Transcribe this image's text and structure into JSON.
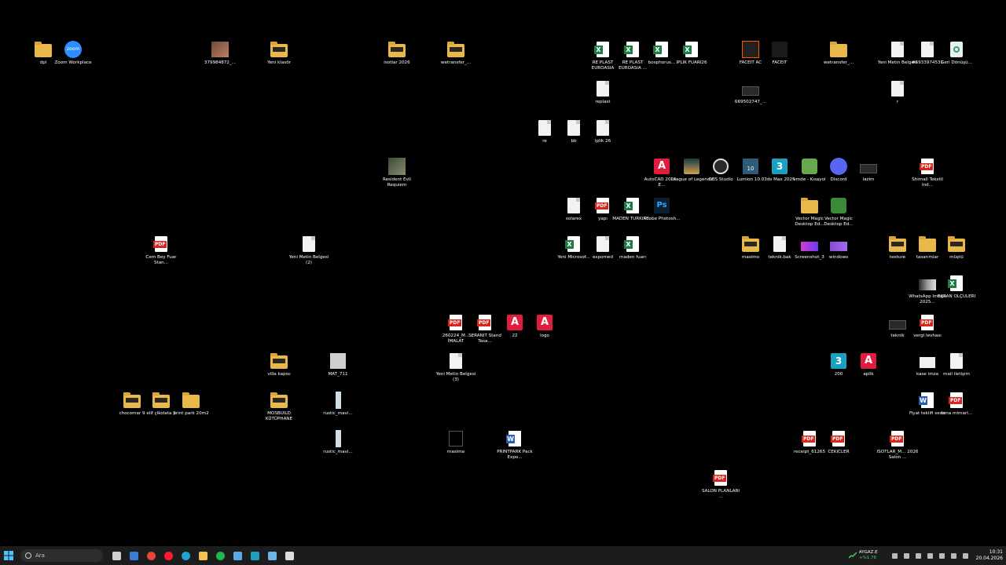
{
  "desktop_icons": [
    {
      "label": "dpi",
      "type": "folder"
    },
    {
      "label": "Zoom Workplace",
      "type": "zoom"
    },
    {
      "label": "379984872_...",
      "type": "img"
    },
    {
      "label": "Yeni klasör",
      "type": "folder-dark"
    },
    {
      "label": "isotlar 2026",
      "type": "folder-dark"
    },
    {
      "label": "wetransfer_...",
      "type": "folder-dark"
    },
    {
      "label": "RE PLAST EUROASIA",
      "type": "xls"
    },
    {
      "label": "RE PLAST EUROASIA ...",
      "type": "xls"
    },
    {
      "label": "bosphorus...",
      "type": "xls"
    },
    {
      "label": "IPLIK FUARI26",
      "type": "xls"
    },
    {
      "label": "FACEIT AC",
      "type": "faceit"
    },
    {
      "label": "FACEIT",
      "type": "faceit2"
    },
    {
      "label": "wetransfer_...",
      "type": "folder"
    },
    {
      "label": "Yeni Metin Belgesi",
      "type": "doc"
    },
    {
      "label": "#6933974531",
      "type": "doc"
    },
    {
      "label": "Geri Dönüşü...",
      "type": "recycle"
    },
    {
      "label": "replast",
      "type": "doc"
    },
    {
      "label": "669502747_...",
      "type": "small"
    },
    {
      "label": "r",
      "type": "doc"
    },
    {
      "label": "re",
      "type": "doc"
    },
    {
      "label": "bb",
      "type": "doc"
    },
    {
      "label": "iplik 26",
      "type": "doc"
    },
    {
      "label": "Resident Evil Requiem",
      "type": "game"
    },
    {
      "label": "AutoCAD 2026 - E...",
      "type": "acad"
    },
    {
      "label": "League of Legends",
      "type": "lol"
    },
    {
      "label": "OBS Studio",
      "type": "obs"
    },
    {
      "label": "Lumion 10.0",
      "type": "lumion"
    },
    {
      "label": "3ds Max 2026",
      "type": "max"
    },
    {
      "label": "vmde - Kısayol",
      "type": "vmde"
    },
    {
      "label": "Discord",
      "type": "discord"
    },
    {
      "label": "lazim",
      "type": "small"
    },
    {
      "label": "Shimall Tekstil Ind...",
      "type": "pdf"
    },
    {
      "label": "solarex",
      "type": "doc"
    },
    {
      "label": "yapı",
      "type": "pdf"
    },
    {
      "label": "MADEN TÜRKİYE...",
      "type": "xls"
    },
    {
      "label": "Adobe Photosh...",
      "type": "ps"
    },
    {
      "label": "Vector Magic Desktop Ed...",
      "type": "folder"
    },
    {
      "label": "Vector Magic Desktop Ed...",
      "type": "vm"
    },
    {
      "label": "Cem Bey Fuar Stan...",
      "type": "pdf"
    },
    {
      "label": "Yeni Metin Belgesi (2)",
      "type": "doc"
    },
    {
      "label": "Yeni Microsof...",
      "type": "xls"
    },
    {
      "label": "expomed",
      "type": "doc"
    },
    {
      "label": "maden fuarı",
      "type": "xls"
    },
    {
      "label": "masimo",
      "type": "folder-dark"
    },
    {
      "label": "teknik.bak",
      "type": "doc"
    },
    {
      "label": "Screenshot_3",
      "type": "img4"
    },
    {
      "label": "windows",
      "type": "img5"
    },
    {
      "label": "texture",
      "type": "folder-dark"
    },
    {
      "label": "tasarımlar",
      "type": "folder"
    },
    {
      "label": "müştü",
      "type": "folder-dark"
    },
    {
      "label": "WhatsApp Image 2025...",
      "type": "img3"
    },
    {
      "label": "EKRAN ÖLÇÜLERİ",
      "type": "xls"
    },
    {
      "label": "260224_M... İMALAT",
      "type": "pdf"
    },
    {
      "label": "SERANİT Stand Tasa...",
      "type": "pdf"
    },
    {
      "label": "22",
      "type": "fbx"
    },
    {
      "label": "logo",
      "type": "fbx"
    },
    {
      "label": "teknik",
      "type": "small"
    },
    {
      "label": "vergi levhası",
      "type": "pdf"
    },
    {
      "label": "villa kapısı",
      "type": "folder-dark"
    },
    {
      "label": "MAT_711",
      "type": "img2"
    },
    {
      "label": "Yeni Metin Belgesi (3)",
      "type": "doc"
    },
    {
      "label": "200",
      "type": "max"
    },
    {
      "label": "aplik",
      "type": "fbx"
    },
    {
      "label": "kase imza",
      "type": "sheet"
    },
    {
      "label": "mail iletişim",
      "type": "doc"
    },
    {
      "label": "chocomar 9",
      "type": "folder-dark"
    },
    {
      "label": "elif çikolata 9",
      "type": "folder-dark"
    },
    {
      "label": "print park 20m2",
      "type": "folder"
    },
    {
      "label": "MOSBUILD KÜTÜPHANE",
      "type": "folder-dark"
    },
    {
      "label": "rustic_mavi...",
      "type": "thin"
    },
    {
      "label": "Fiyat teklifi sedir",
      "type": "word"
    },
    {
      "label": "sona mimarl...",
      "type": "pdf"
    },
    {
      "label": "rustic_mavi...",
      "type": "thin"
    },
    {
      "label": "masima",
      "type": "masima"
    },
    {
      "label": "PRINTPARK Pack Expo...",
      "type": "word"
    },
    {
      "label": "receipt_61265",
      "type": "pdf"
    },
    {
      "label": "CEKICLER",
      "type": "pdf"
    },
    {
      "label": "İSOTLAR_M... 2026 Salon ...",
      "type": "pdf"
    },
    {
      "label": "SALON PLANLARI ...",
      "type": "pdf"
    }
  ],
  "taskbar": {
    "search_placeholder": "Ara",
    "apps": [
      "task-view",
      "mail",
      "chrome",
      "opera",
      "edge",
      "file-explorer",
      "spotify",
      "steam",
      "3ds-max",
      "notepad",
      "gamebar"
    ]
  },
  "tray": {
    "stock_name": "AYGAZ.E",
    "stock_change": "+%1,76",
    "time": "10:31",
    "date": "20.04.2026"
  },
  "icon_glyph_text": {
    "pdf": "PDF",
    "xls": "X",
    "word": "W",
    "acad": "A",
    "fbx": "A",
    "max": "3",
    "ps": "Ps",
    "zoom": "zoom",
    "lumion": "10"
  }
}
